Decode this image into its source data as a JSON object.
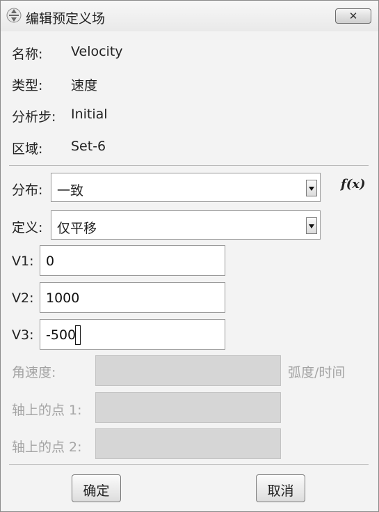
{
  "window": {
    "title": "编辑预定义场",
    "close_label": "✕"
  },
  "info": {
    "name_label": "名称:",
    "name_value": "Velocity",
    "type_label": "类型:",
    "type_value": "速度",
    "step_label": "分析步:",
    "step_value": "Initial",
    "region_label": "区域:",
    "region_value": "Set-6"
  },
  "distribution": {
    "label": "分布:",
    "value": "一致",
    "fx_label": "f(x)"
  },
  "definition": {
    "label": "定义:",
    "value": "仅平移"
  },
  "velocity": {
    "v1_label": "V1:",
    "v1_value": "0",
    "v2_label": "V2:",
    "v2_value": "1000",
    "v3_label": "V3:",
    "v3_value": "-500"
  },
  "angular": {
    "angular_velocity_label": "角速度:",
    "unit_label": "弧度/时间",
    "axis_point1_label": "轴上的点 1:",
    "axis_point2_label": "轴上的点 2:"
  },
  "buttons": {
    "ok_label": "确定",
    "cancel_label": "取消"
  },
  "colors": {
    "window_bg": "#f3f3f3",
    "disabled_field": "#d6d6d6",
    "disabled_text": "#a4a4a4"
  }
}
